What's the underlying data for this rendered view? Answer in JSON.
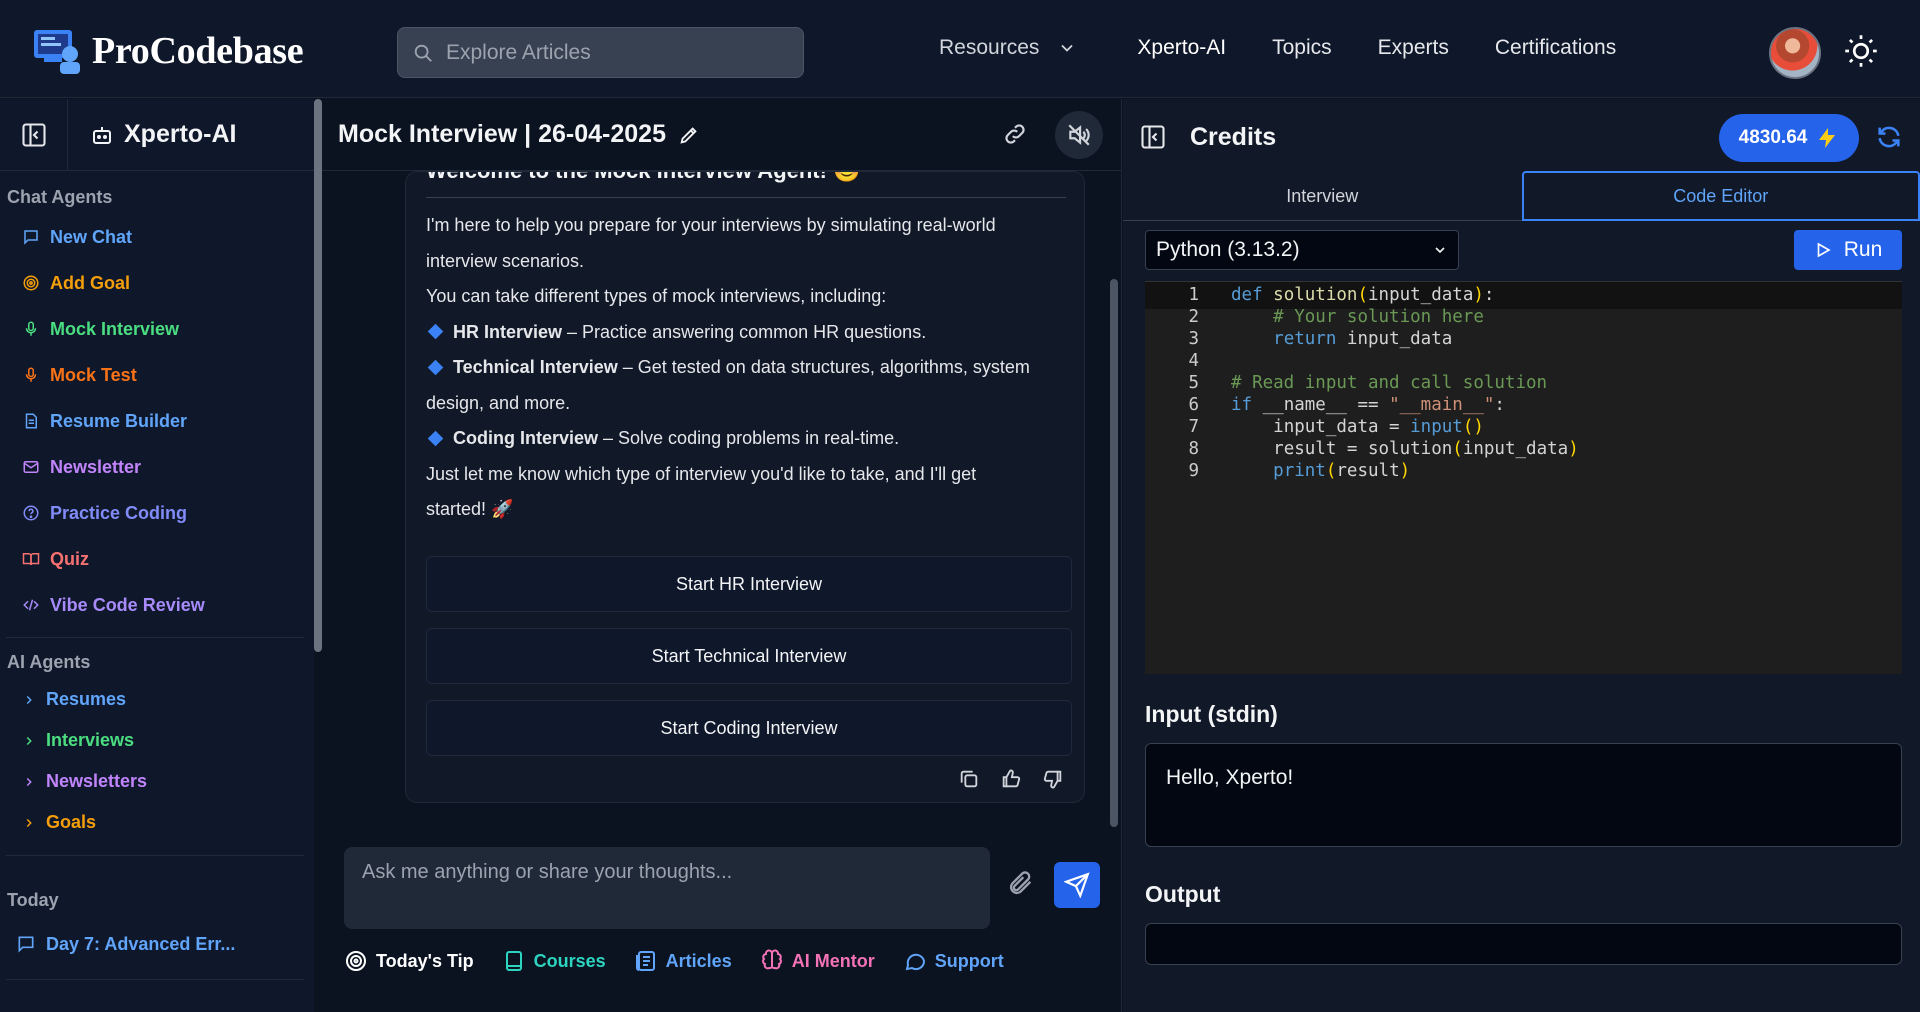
{
  "brand": {
    "name": "ProCodebase"
  },
  "search": {
    "placeholder": "Explore Articles"
  },
  "nav": {
    "resources_label": "Resources",
    "links": [
      "Xperto-AI",
      "Topics",
      "Experts",
      "Certifications"
    ]
  },
  "sidebar": {
    "title": "Xperto-AI",
    "chat_agents_heading": "Chat Agents",
    "chat_agents": [
      {
        "label": "New Chat",
        "icon": "chat-icon",
        "color": "#60a5fa"
      },
      {
        "label": "Add Goal",
        "icon": "target-icon",
        "color": "#f59e0b"
      },
      {
        "label": "Mock Interview",
        "icon": "microphone-icon",
        "color": "#4ade80"
      },
      {
        "label": "Mock Test",
        "icon": "microphone-icon",
        "color": "#f97316"
      },
      {
        "label": "Resume Builder",
        "icon": "document-icon",
        "color": "#60a5fa"
      },
      {
        "label": "Newsletter",
        "icon": "mail-icon",
        "color": "#c084fc"
      },
      {
        "label": "Practice Coding",
        "icon": "help-circle-icon",
        "color": "#818cf8"
      },
      {
        "label": "Quiz",
        "icon": "book-icon",
        "color": "#f87171"
      },
      {
        "label": "Vibe Code Review",
        "icon": "code-icon",
        "color": "#a78bfa"
      }
    ],
    "ai_agents_heading": "AI Agents",
    "ai_agents": [
      {
        "label": "Resumes",
        "color": "#60a5fa"
      },
      {
        "label": "Interviews",
        "color": "#4ade80"
      },
      {
        "label": "Newsletters",
        "color": "#c084fc"
      },
      {
        "label": "Goals",
        "color": "#f59e0b"
      }
    ],
    "today_heading": "Today",
    "history": [
      {
        "label": "Day 7: Advanced Err..."
      }
    ]
  },
  "chat": {
    "title": "Mock Interview | 26-04-2025",
    "message": {
      "welcome": "Welcome to the Mock Interview Agent! 😊",
      "intro1": "I'm here to help you prepare for your interviews by simulating real-world",
      "intro2": "interview scenarios.",
      "types_line": "You can take different types of mock interviews, including:",
      "hr_title": "HR Interview",
      "hr_desc": " – Practice answering common HR questions.",
      "tech_title": "Technical Interview",
      "tech_desc": " – Get tested on data structures, algorithms, system",
      "tech_desc2": "design, and more.",
      "coding_title": "Coding Interview",
      "coding_desc": " – Solve coding problems in real-time.",
      "closing1": "Just let me know which type of interview you'd like to take, and I'll get",
      "closing2": "started! 🚀"
    },
    "buttons": [
      "Start HR Interview",
      "Start Technical Interview",
      "Start Coding Interview"
    ],
    "composer_placeholder": "Ask me anything or share your thoughts...",
    "quick_actions": [
      {
        "label": "Today's Tip",
        "icon": "target-icon",
        "color": "#ffffff"
      },
      {
        "label": "Courses",
        "icon": "book-icon",
        "color": "#2dd4bf"
      },
      {
        "label": "Articles",
        "icon": "newspaper-icon",
        "color": "#60a5fa"
      },
      {
        "label": "AI Mentor",
        "icon": "brain-icon",
        "color": "#f472b6"
      },
      {
        "label": "Support",
        "icon": "chat-bubble-icon",
        "color": "#60a5fa"
      }
    ]
  },
  "right": {
    "title": "Credits",
    "credits": "4830.64",
    "tabs": [
      "Interview",
      "Code Editor"
    ],
    "language": "Python (3.13.2)",
    "run_label": "Run",
    "code_lines": [
      "def solution(input_data):",
      "    # Your solution here",
      "    return input_data",
      "",
      "# Read input and call solution",
      "if __name__ == \"__main__\":",
      "    input_data = input()",
      "    result = solution(input_data)",
      "    print(result)"
    ],
    "input_label": "Input (stdin)",
    "input_value": "Hello, Xperto!",
    "output_label": "Output",
    "output_value": ""
  }
}
